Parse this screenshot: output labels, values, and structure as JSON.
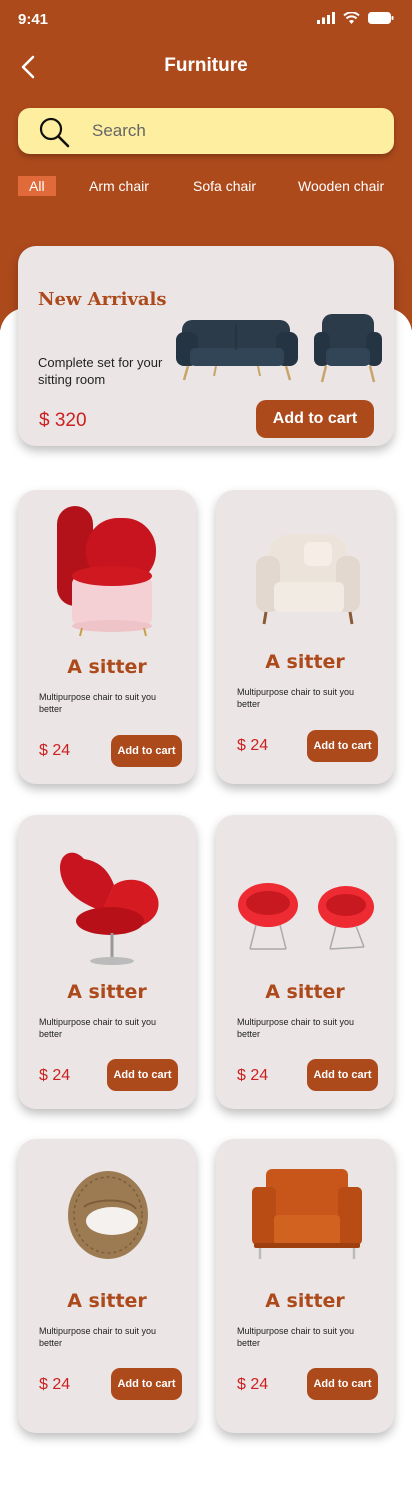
{
  "status_bar": {
    "time": "9:41"
  },
  "header": {
    "title": "Furniture"
  },
  "search": {
    "placeholder": "Search"
  },
  "filters": [
    "All",
    "Arm chair",
    "Sofa chair",
    "Wooden chair"
  ],
  "featured": {
    "title": "New Arrivals",
    "description": "Complete set for your sitting room",
    "price": "$ 320",
    "button": "Add to cart"
  },
  "products": [
    {
      "name": "A sitter",
      "description": "Multipurpose chair to suit you better",
      "price": "$ 24",
      "button": "Add to cart",
      "image": "red-pink-armchair"
    },
    {
      "name": "A sitter",
      "description": "Multipurpose chair to suit you better",
      "price": "$ 24",
      "button": "Add to cart",
      "image": "cream-armchair"
    },
    {
      "name": "A sitter",
      "description": "Multipurpose chair to suit you better",
      "price": "$ 24",
      "button": "Add to cart",
      "image": "red-heart-chair"
    },
    {
      "name": "A sitter",
      "description": "Multipurpose chair to suit you better",
      "price": "$ 24",
      "button": "Add to cart",
      "image": "red-bowl-chairs"
    },
    {
      "name": "A sitter",
      "description": "Multipurpose chair to suit you better",
      "price": "$ 24",
      "button": "Add to cart",
      "image": "wicker-chair"
    },
    {
      "name": "A sitter",
      "description": "Multipurpose chair to suit you better",
      "price": "$ 24",
      "button": "Add to cart",
      "image": "orange-armchair"
    }
  ],
  "colors": {
    "brand": "#ad4a1c",
    "search_bg": "#fdeea0",
    "card_bg": "#ebe6e5",
    "price": "#cc2020",
    "chip_active": "#e06a3a"
  }
}
